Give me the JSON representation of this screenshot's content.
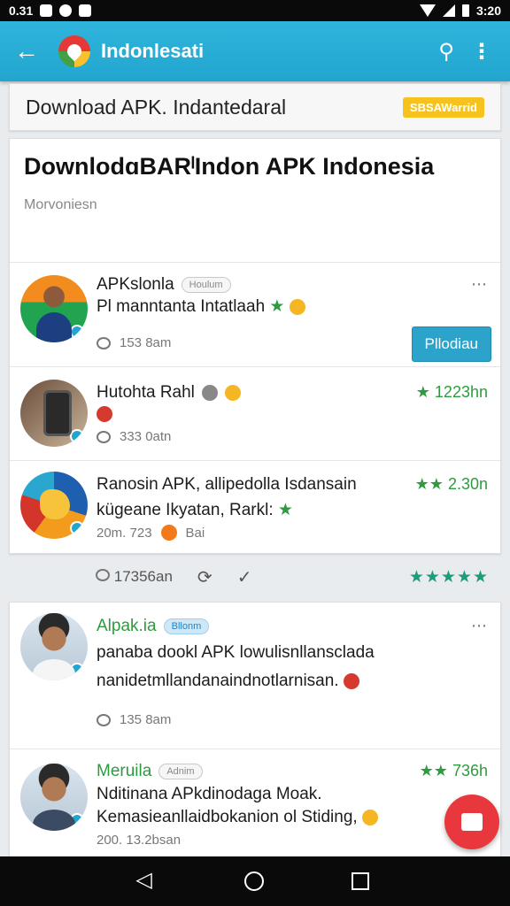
{
  "status_bar": {
    "time_left": "0.31",
    "time_right": "3:20"
  },
  "app_bar": {
    "title": "Indonlesati"
  },
  "header_strip": {
    "title": "Download APK. Indantedaral",
    "badge": "SBSAWarrid"
  },
  "featured": {
    "title": "DownlodɑBARˡIndon APK Indonesia",
    "subtitle": "Morvoniesn"
  },
  "posts": [
    {
      "name": "APKslonla",
      "tag": "Houlum",
      "line1": "Pl manntanta Intatlaah",
      "meta": "153 8am",
      "button": "Pllodiau"
    },
    {
      "name": "Hutohta Rahl",
      "meta": "333 0atn",
      "rating": "1223hn"
    },
    {
      "name": "Ranosin APK, allipedolla Isdansain",
      "line1": "kügeane Ikyatan, Rarkl:",
      "meta": "20m. 723",
      "meta_tail": "Bai",
      "rating": "2.30n"
    }
  ],
  "actions": {
    "count": "17356an"
  },
  "posts2": [
    {
      "name": "Alpak.ia",
      "tag": "Bllonm",
      "line1": "panaba dookl APK lowulisnllansclada",
      "line2": "nanidetmllandanaindnotlarnisan.",
      "meta": "135 8am"
    },
    {
      "name": "Meruila",
      "tag": "Adnim",
      "line1": "Nditinana APkdinodaga Moak.",
      "line2": "Kemasieanllaidbokanion ol Stiding,",
      "meta": "200. 13.2bsan",
      "rating": "736h"
    }
  ],
  "colors": {
    "primary": "#22a6cf",
    "accent_green": "#2e9b3e",
    "fab": "#e8383d"
  }
}
